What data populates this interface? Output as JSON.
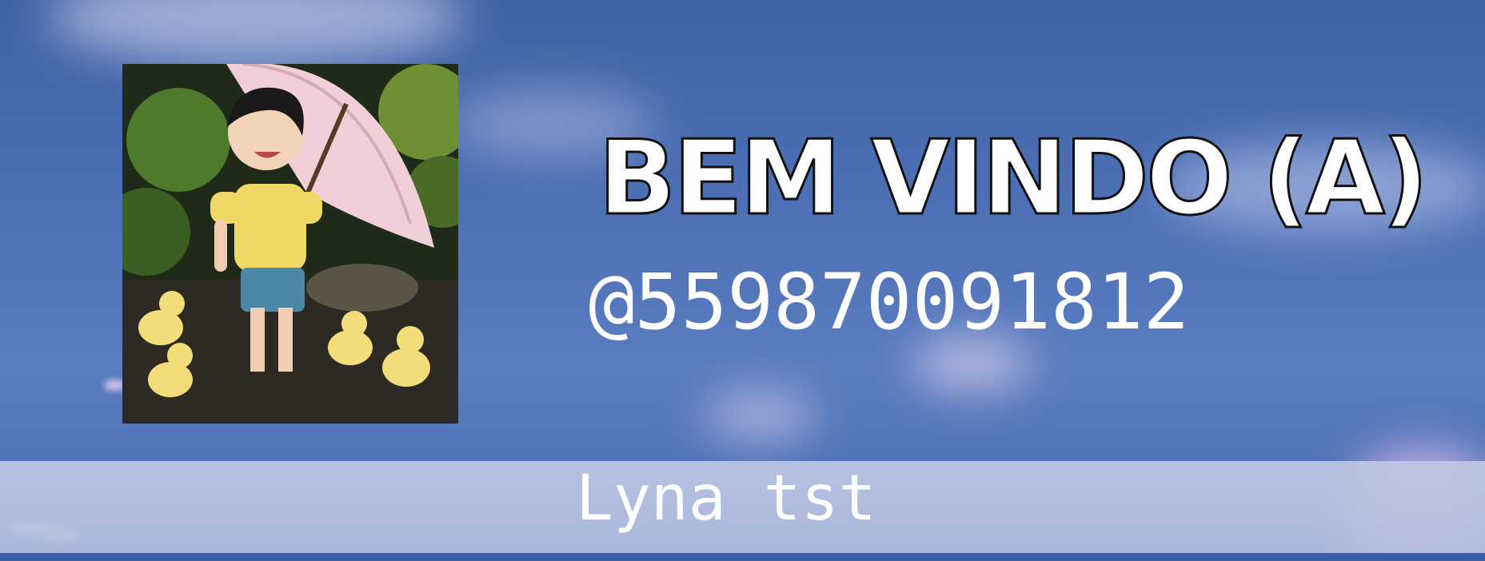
{
  "welcome": {
    "title": "BEM VINDO (A)",
    "handle": "@559870091812",
    "name": "Lyna tst"
  },
  "avatar": {
    "description_icon": "avatar-illustration"
  },
  "colors": {
    "background": "#4c6fb5",
    "bar": "#bec8e4",
    "text": "#ffffff",
    "title_outline": "#111111"
  }
}
